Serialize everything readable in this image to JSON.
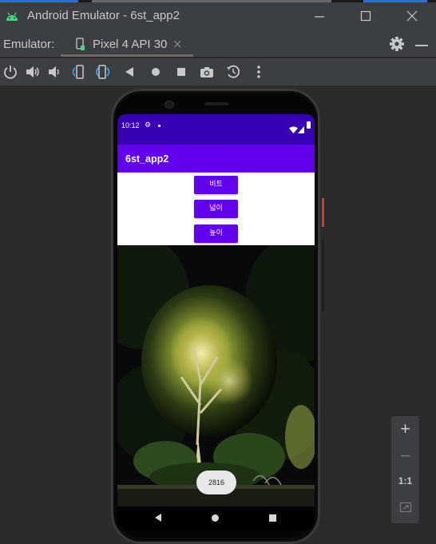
{
  "window": {
    "title": "Android Emulator - 6st_app2",
    "minimize_icon": "minimize-icon",
    "maximize_icon": "maximize-icon",
    "close_icon": "close-icon"
  },
  "tabbar": {
    "emulator_label": "Emulator:",
    "tab_label": "Pixel 4 API 30",
    "tab_close": "×"
  },
  "toolbar": {
    "icons": [
      "power-icon",
      "volume-up-icon",
      "volume-down-icon",
      "rotate-left-icon",
      "rotate-right-icon",
      "back-icon",
      "home-icon",
      "overview-icon",
      "screenshot-icon",
      "snapshot-icon",
      "more-icon"
    ]
  },
  "device": {
    "status_time": "10:12",
    "app_title": "6st_app2",
    "buttons": [
      "비트",
      "넓이",
      "높이"
    ],
    "toast_text": "2816",
    "accent": "#6200ee",
    "status_color": "#3700b3"
  },
  "zoom": {
    "plus": "+",
    "minus": "−",
    "one_to_one": "1:1"
  }
}
